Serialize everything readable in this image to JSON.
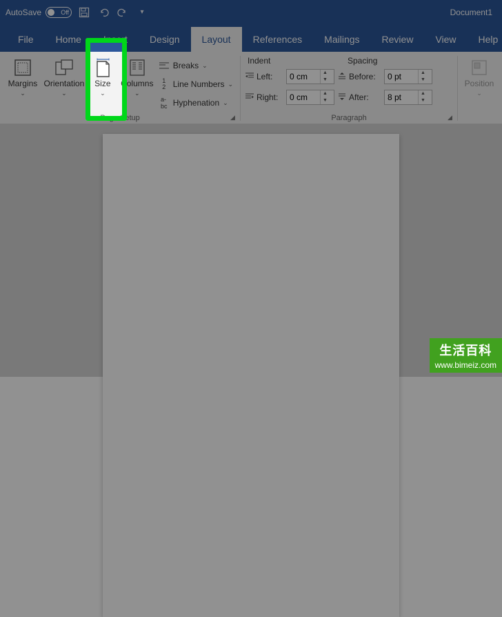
{
  "title_bar": {
    "autosave_label": "AutoSave",
    "autosave_state": "Off",
    "doc_title": "Document1"
  },
  "tabs": {
    "file": "File",
    "home": "Home",
    "insert": "Insert",
    "design": "Design",
    "layout": "Layout",
    "references": "References",
    "mailings": "Mailings",
    "review": "Review",
    "view": "View",
    "help": "Help"
  },
  "ribbon": {
    "page_setup": {
      "margins": "Margins",
      "orientation": "Orientation",
      "size": "Size",
      "columns": "Columns",
      "breaks": "Breaks",
      "line_numbers": "Line Numbers",
      "hyphenation": "Hyphenation",
      "group_label": "Page Setup"
    },
    "paragraph": {
      "indent_header": "Indent",
      "spacing_header": "Spacing",
      "left_label": "Left:",
      "right_label": "Right:",
      "before_label": "Before:",
      "after_label": "After:",
      "left_value": "0 cm",
      "right_value": "0 cm",
      "before_value": "0 pt",
      "after_value": "8 pt",
      "group_label": "Paragraph"
    },
    "arrange": {
      "position": "Position"
    }
  },
  "badge": {
    "line1": "生活百科",
    "line2": "www.bimeiz.com"
  }
}
